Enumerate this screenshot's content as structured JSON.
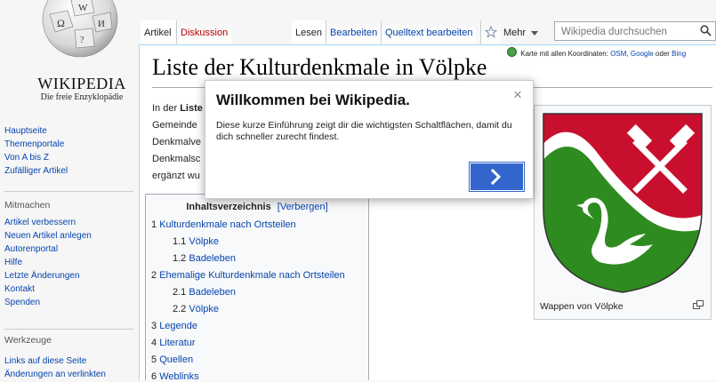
{
  "logo": {
    "wordmark": "WIKIPEDIA",
    "tagline": "Die freie Enzyklopädie"
  },
  "sidebar": {
    "nav": [
      "Hauptseite",
      "Themenportale",
      "Von A bis Z",
      "Zufälliger Artikel"
    ],
    "mitmachen_heading": "Mitmachen",
    "mitmachen": [
      "Artikel verbessern",
      "Neuen Artikel anlegen",
      "Autorenportal",
      "Hilfe",
      "Letzte Änderungen",
      "Kontakt",
      "Spenden"
    ],
    "werkzeuge_heading": "Werkzeuge",
    "werkzeuge": [
      "Links auf diese Seite",
      "Änderungen an verlinkten"
    ]
  },
  "tabs": {
    "artikel": "Artikel",
    "diskussion": "Diskussion",
    "lesen": "Lesen",
    "bearbeiten": "Bearbeiten",
    "quelltext": "Quelltext bearbeiten",
    "mehr": "Mehr"
  },
  "search": {
    "placeholder": "Wikipedia durchsuchen"
  },
  "coords": {
    "prefix": "Karte mit allen Koordinaten:",
    "osm": "OSM",
    "google": "Google",
    "oder": "oder",
    "bing": "Bing"
  },
  "page": {
    "title": "Liste der Kulturdenkmale in Völpke",
    "intro_lines": [
      {
        "prefix": "In der ",
        "bold": "Liste"
      },
      {
        "prefix": "Gemeinde ",
        "bold": ""
      },
      {
        "prefix": "Denkmalve",
        "bold": ""
      },
      {
        "prefix": "Denkmalsc",
        "bold": ""
      },
      {
        "prefix": "ergänzt wu",
        "bold": ""
      }
    ]
  },
  "toc": {
    "title": "Inhaltsverzeichnis",
    "toggle": "[Verbergen]",
    "items": [
      {
        "num": "1",
        "label": "Kulturdenkmale nach Ortsteilen",
        "level": 1
      },
      {
        "num": "1.1",
        "label": "Völpke",
        "level": 2
      },
      {
        "num": "1.2",
        "label": "Badeleben",
        "level": 2
      },
      {
        "num": "2",
        "label": "Ehemalige Kulturdenkmale nach Ortsteilen",
        "level": 1
      },
      {
        "num": "2.1",
        "label": "Badeleben",
        "level": 2
      },
      {
        "num": "2.2",
        "label": "Völpke",
        "level": 2
      },
      {
        "num": "3",
        "label": "Legende",
        "level": 1
      },
      {
        "num": "4",
        "label": "Literatur",
        "level": 1
      },
      {
        "num": "5",
        "label": "Quellen",
        "level": 1
      },
      {
        "num": "6",
        "label": "Weblinks",
        "level": 1
      }
    ]
  },
  "infobox": {
    "caption": "Wappen von Völpke"
  },
  "modal": {
    "title": "Willkommen bei Wikipedia.",
    "text": "Diese kurze Einführung zeigt dir die wichtigsten Schaltflächen, damit du dich schneller zurecht findest.",
    "close": "×"
  },
  "colors": {
    "link": "#0645ad",
    "new_link": "#ba0000",
    "button": "#3366cc",
    "coat_red": "#c8102e",
    "coat_green": "#2e8b1f"
  }
}
